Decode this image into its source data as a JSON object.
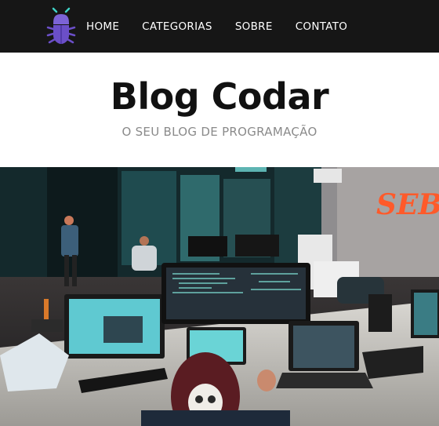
{
  "nav": {
    "logo": "bug-logo",
    "links": [
      "HOME",
      "CATEGORIAS",
      "SOBRE",
      "CONTATO"
    ]
  },
  "header": {
    "title": "Blog Codar",
    "subtitle": "O SEU BLOG DE PROGRAMAÇÃO"
  },
  "hero": {
    "image": "office-programmer-photo",
    "sign_text": "SEB"
  },
  "colors": {
    "navbar_bg": "#161616",
    "logo_purple": "#6b4fc8",
    "logo_antenna": "#3fd3c8",
    "title": "#111111",
    "subtitle": "#8a8a8a"
  }
}
